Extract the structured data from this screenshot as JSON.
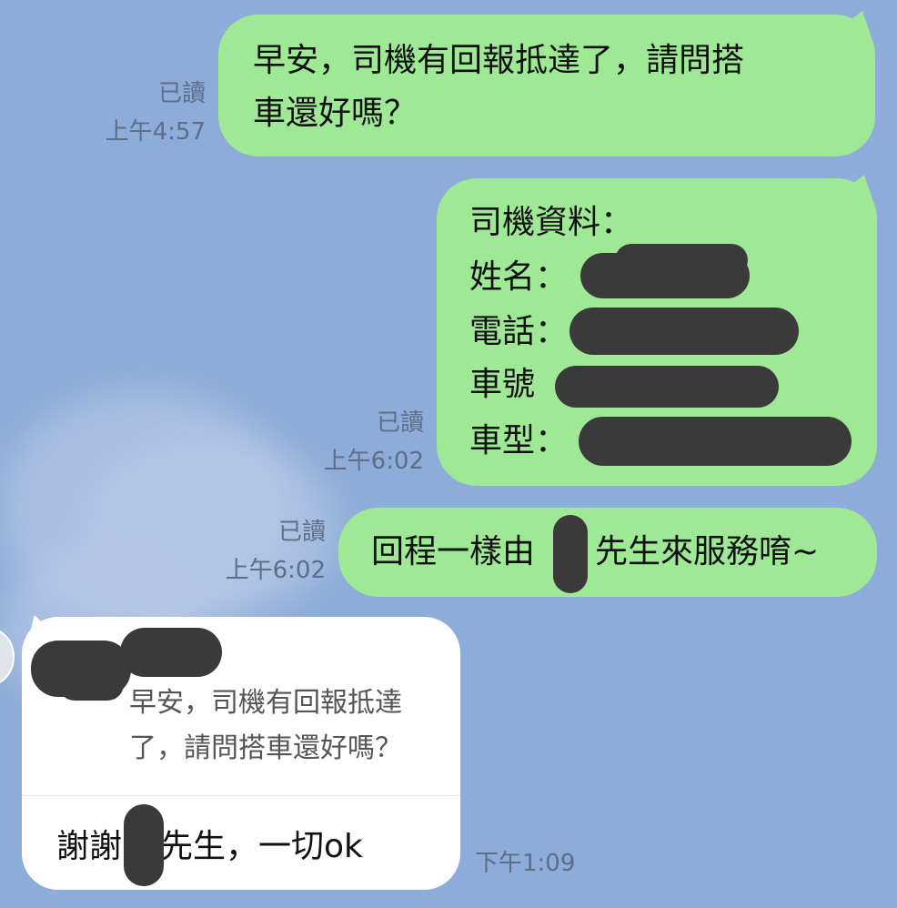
{
  "colors": {
    "background": "#8eacd9",
    "outgoing_bubble": "#9ee896",
    "incoming_bubble": "#ffffff",
    "meta_text": "#5d6e88",
    "redaction": "#3a3a3a"
  },
  "messages": [
    {
      "id": "m1",
      "direction": "outgoing",
      "read_label": "已讀",
      "time": "上午4:57",
      "lines": [
        "早安，司機有回報抵達了，請問搭",
        "車還好嗎？"
      ]
    },
    {
      "id": "m2",
      "direction": "outgoing",
      "read_label": "已讀",
      "time": "上午6:02",
      "lines": [
        "司機資料：",
        "姓名：",
        "電話：",
        "車號",
        "車型："
      ],
      "redacted_fields": [
        "name",
        "phone",
        "plate",
        "model"
      ]
    },
    {
      "id": "m3",
      "direction": "outgoing",
      "read_label": "已讀",
      "time": "上午6:02",
      "lines": [
        "回程一樣由",
        "先生來服務唷~"
      ]
    },
    {
      "id": "m4",
      "direction": "incoming",
      "time": "下午1:09",
      "quoted": [
        "早安，司機有回報抵達",
        "了，請問搭車還好嗎？"
      ],
      "reply": [
        "謝謝",
        "先生，一切ok"
      ]
    }
  ]
}
